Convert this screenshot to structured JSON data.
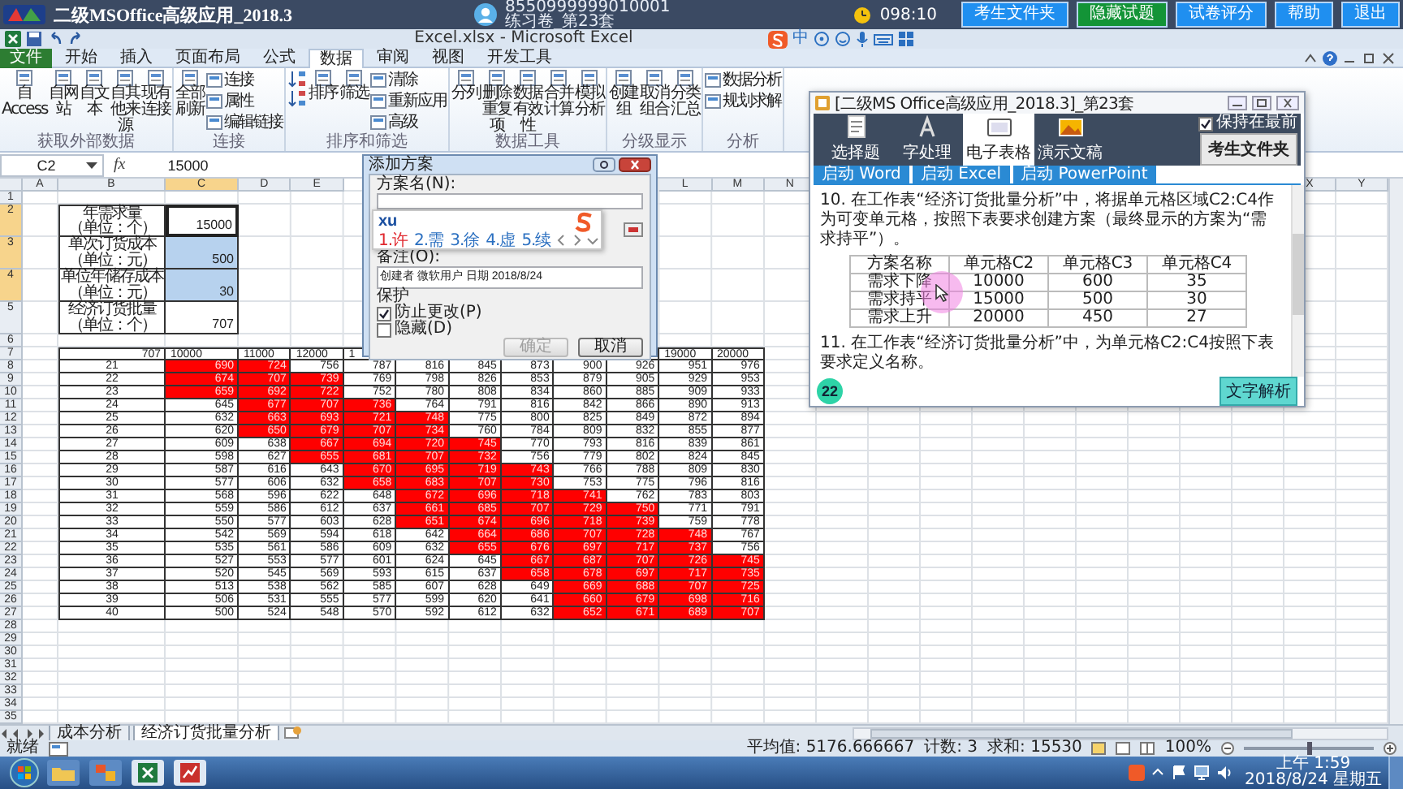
{
  "exam_bar": {
    "title": "二级MSOffice高级应用_2018.3",
    "user_id": "8550999999010001",
    "paper": "练习卷_第23套",
    "timer": "098:10",
    "buttons": [
      {
        "label": "考生文件夹",
        "kind": "normal"
      },
      {
        "label": "隐藏试题",
        "kind": "highlight"
      },
      {
        "label": "试卷评分",
        "kind": "normal"
      },
      {
        "label": "帮助",
        "kind": "normal"
      },
      {
        "label": "退出",
        "kind": "normal"
      }
    ]
  },
  "excel": {
    "window_title": "Excel.xlsx - Microsoft Excel",
    "ime_mode": "中",
    "ribbon_tabs": [
      {
        "label": "文件",
        "kind": "file",
        "selected": false
      },
      {
        "label": "开始",
        "kind": "tab",
        "selected": false
      },
      {
        "label": "插入",
        "kind": "tab",
        "selected": false
      },
      {
        "label": "页面布局",
        "kind": "tab",
        "selected": false
      },
      {
        "label": "公式",
        "kind": "tab",
        "selected": false
      },
      {
        "label": "数据",
        "kind": "tab",
        "selected": true
      },
      {
        "label": "审阅",
        "kind": "tab",
        "selected": false
      },
      {
        "label": "视图",
        "kind": "tab",
        "selected": false
      },
      {
        "label": "开发工具",
        "kind": "tab",
        "selected": false
      }
    ],
    "ribbon_groups": [
      {
        "label": "获取外部数据",
        "items": [
          {
            "kind": "large",
            "label": "自 Access"
          },
          {
            "kind": "large",
            "label": "自网站"
          },
          {
            "kind": "large",
            "label": "自文本"
          },
          {
            "kind": "large",
            "label": "自其他来源"
          },
          {
            "kind": "large",
            "label": "现有连接"
          }
        ]
      },
      {
        "label": "连接",
        "items": [
          {
            "kind": "large",
            "label": "全部刷新"
          },
          {
            "kind": "small",
            "label": "连接"
          },
          {
            "kind": "small",
            "label": "属性"
          },
          {
            "kind": "small",
            "label": "编辑链接"
          }
        ]
      },
      {
        "label": "排序和筛选",
        "items": [
          {
            "kind": "sort"
          },
          {
            "kind": "large",
            "label": "排序"
          },
          {
            "kind": "large",
            "label": "筛选"
          },
          {
            "kind": "small",
            "label": "清除"
          },
          {
            "kind": "small",
            "label": "重新应用"
          },
          {
            "kind": "small",
            "label": "高级"
          }
        ]
      },
      {
        "label": "数据工具",
        "items": [
          {
            "kind": "large",
            "label": "分列"
          },
          {
            "kind": "large",
            "label": "删除重复项"
          },
          {
            "kind": "large",
            "label": "数据有效性"
          },
          {
            "kind": "large",
            "label": "合并计算"
          },
          {
            "kind": "large",
            "label": "模拟分析"
          }
        ]
      },
      {
        "label": "分级显示",
        "items": [
          {
            "kind": "large",
            "label": "创建组"
          },
          {
            "kind": "large",
            "label": "取消组合"
          },
          {
            "kind": "large",
            "label": "分类汇总"
          }
        ]
      },
      {
        "label": "分析",
        "items": [
          {
            "kind": "small",
            "label": "数据分析"
          },
          {
            "kind": "small",
            "label": "规划求解"
          }
        ]
      }
    ],
    "name_box": "C2",
    "function_label": "fx",
    "formula": "15000"
  },
  "sheet": {
    "columns": [
      {
        "label": "A",
        "selected": false
      },
      {
        "label": "B",
        "selected": false
      },
      {
        "label": "C",
        "selected": true
      },
      {
        "label": "D",
        "selected": false
      },
      {
        "label": "E",
        "selected": false
      },
      null,
      null,
      null,
      null,
      null,
      null,
      {
        "label": "L",
        "selected": false
      },
      {
        "label": "M",
        "selected": false
      },
      {
        "label": "N",
        "selected": false
      },
      null,
      null,
      null,
      null,
      null,
      null,
      null,
      null,
      null,
      {
        "label": "X",
        "selected": false
      },
      {
        "label": "Y",
        "selected": false
      }
    ],
    "rows": [
      {
        "label": "1",
        "selected": false
      },
      {
        "label": "2",
        "selected": true
      },
      {
        "label": "3",
        "selected": true
      },
      {
        "label": "4",
        "selected": true
      },
      {
        "label": "5",
        "selected": false
      },
      {
        "label": "6",
        "selected": false
      },
      {
        "label": "7",
        "selected": false
      },
      {
        "label": "8",
        "selected": false
      },
      {
        "label": "9",
        "selected": false
      },
      {
        "label": "10",
        "selected": false
      },
      {
        "label": "11",
        "selected": false
      },
      {
        "label": "12",
        "selected": false
      },
      {
        "label": "13",
        "selected": false
      },
      {
        "label": "14",
        "selected": false
      },
      {
        "label": "15",
        "selected": false
      },
      {
        "label": "16",
        "selected": false
      },
      {
        "label": "17",
        "selected": false
      },
      {
        "label": "18",
        "selected": false
      },
      {
        "label": "19",
        "selected": false
      },
      {
        "label": "20",
        "selected": false
      },
      {
        "label": "21",
        "selected": false
      },
      {
        "label": "22",
        "selected": false
      },
      {
        "label": "23",
        "selected": false
      },
      {
        "label": "24",
        "selected": false
      },
      {
        "label": "25",
        "selected": false
      },
      {
        "label": "26",
        "selected": false
      },
      {
        "label": "27",
        "selected": false
      },
      {
        "label": "28",
        "selected": false
      },
      {
        "label": "29",
        "selected": false
      },
      {
        "label": "30",
        "selected": false
      },
      {
        "label": "31",
        "selected": false
      },
      {
        "label": "32",
        "selected": false
      },
      {
        "label": "33",
        "selected": false
      },
      {
        "label": "34",
        "selected": false
      },
      {
        "label": "35",
        "selected": false
      }
    ],
    "input_block": [
      {
        "label": "年需求量",
        "unit": "（单位：个）",
        "value": "15000",
        "selected": false,
        "active": true
      },
      {
        "label": "单次订货成本",
        "unit": "（单位：元）",
        "value": "500",
        "selected": true,
        "active": false
      },
      {
        "label": "单位年储存成本",
        "unit": "（单位：元）",
        "value": "30",
        "selected": true,
        "active": false
      },
      {
        "label": "经济订货批量",
        "unit": "（单位：个）",
        "value": "707",
        "selected": false,
        "active": false
      }
    ],
    "table": {
      "corner": "707",
      "columns": [
        "10000",
        "11000",
        "12000",
        "1",
        null,
        null,
        null,
        null,
        null,
        "19000",
        "20000"
      ],
      "rows": [
        {
          "label": "21",
          "cells": [
            "690",
            "724",
            "756",
            "787",
            "816",
            "845",
            "873",
            "900",
            "926",
            "951",
            "976"
          ],
          "highlighted": [
            true,
            true,
            false,
            false,
            false,
            false,
            false,
            false,
            false,
            false,
            false
          ]
        },
        {
          "label": "22",
          "cells": [
            "674",
            "707",
            "739",
            "769",
            "798",
            "826",
            "853",
            "879",
            "905",
            "929",
            "953"
          ],
          "highlighted": [
            true,
            true,
            true,
            false,
            false,
            false,
            false,
            false,
            false,
            false,
            false
          ]
        },
        {
          "label": "23",
          "cells": [
            "659",
            "692",
            "722",
            "752",
            "780",
            "808",
            "834",
            "860",
            "885",
            "909",
            "933"
          ],
          "highlighted": [
            true,
            true,
            true,
            false,
            false,
            false,
            false,
            false,
            false,
            false,
            false
          ]
        },
        {
          "label": "24",
          "cells": [
            "645",
            "677",
            "707",
            "736",
            "764",
            "791",
            "816",
            "842",
            "866",
            "890",
            "913"
          ],
          "highlighted": [
            false,
            true,
            true,
            true,
            false,
            false,
            false,
            false,
            false,
            false,
            false
          ]
        },
        {
          "label": "25",
          "cells": [
            "632",
            "663",
            "693",
            "721",
            "748",
            "775",
            "800",
            "825",
            "849",
            "872",
            "894"
          ],
          "highlighted": [
            false,
            true,
            true,
            true,
            true,
            false,
            false,
            false,
            false,
            false,
            false
          ]
        },
        {
          "label": "26",
          "cells": [
            "620",
            "650",
            "679",
            "707",
            "734",
            "760",
            "784",
            "809",
            "832",
            "855",
            "877"
          ],
          "highlighted": [
            false,
            true,
            true,
            true,
            true,
            false,
            false,
            false,
            false,
            false,
            false
          ]
        },
        {
          "label": "27",
          "cells": [
            "609",
            "638",
            "667",
            "694",
            "720",
            "745",
            "770",
            "793",
            "816",
            "839",
            "861"
          ],
          "highlighted": [
            false,
            false,
            true,
            true,
            true,
            true,
            false,
            false,
            false,
            false,
            false
          ]
        },
        {
          "label": "28",
          "cells": [
            "598",
            "627",
            "655",
            "681",
            "707",
            "732",
            "756",
            "779",
            "802",
            "824",
            "845"
          ],
          "highlighted": [
            false,
            false,
            true,
            true,
            true,
            true,
            false,
            false,
            false,
            false,
            false
          ]
        },
        {
          "label": "29",
          "cells": [
            "587",
            "616",
            "643",
            "670",
            "695",
            "719",
            "743",
            "766",
            "788",
            "809",
            "830"
          ],
          "highlighted": [
            false,
            false,
            false,
            true,
            true,
            true,
            true,
            false,
            false,
            false,
            false
          ]
        },
        {
          "label": "30",
          "cells": [
            "577",
            "606",
            "632",
            "658",
            "683",
            "707",
            "730",
            "753",
            "775",
            "796",
            "816"
          ],
          "highlighted": [
            false,
            false,
            false,
            true,
            true,
            true,
            true,
            false,
            false,
            false,
            false
          ]
        },
        {
          "label": "31",
          "cells": [
            "568",
            "596",
            "622",
            "648",
            "672",
            "696",
            "718",
            "741",
            "762",
            "783",
            "803"
          ],
          "highlighted": [
            false,
            false,
            false,
            false,
            true,
            true,
            true,
            true,
            false,
            false,
            false
          ]
        },
        {
          "label": "32",
          "cells": [
            "559",
            "586",
            "612",
            "637",
            "661",
            "685",
            "707",
            "729",
            "750",
            "771",
            "791"
          ],
          "highlighted": [
            false,
            false,
            false,
            false,
            true,
            true,
            true,
            true,
            true,
            false,
            false
          ]
        },
        {
          "label": "33",
          "cells": [
            "550",
            "577",
            "603",
            "628",
            "651",
            "674",
            "696",
            "718",
            "739",
            "759",
            "778"
          ],
          "highlighted": [
            false,
            false,
            false,
            false,
            true,
            true,
            true,
            true,
            true,
            false,
            false
          ]
        },
        {
          "label": "34",
          "cells": [
            "542",
            "569",
            "594",
            "618",
            "642",
            "664",
            "686",
            "707",
            "728",
            "748",
            "767"
          ],
          "highlighted": [
            false,
            false,
            false,
            false,
            false,
            true,
            true,
            true,
            true,
            true,
            false
          ]
        },
        {
          "label": "35",
          "cells": [
            "535",
            "561",
            "586",
            "609",
            "632",
            "655",
            "676",
            "697",
            "717",
            "737",
            "756"
          ],
          "highlighted": [
            false,
            false,
            false,
            false,
            false,
            true,
            true,
            true,
            true,
            true,
            false
          ]
        },
        {
          "label": "36",
          "cells": [
            "527",
            "553",
            "577",
            "601",
            "624",
            "645",
            "667",
            "687",
            "707",
            "726",
            "745"
          ],
          "highlighted": [
            false,
            false,
            false,
            false,
            false,
            false,
            true,
            true,
            true,
            true,
            true
          ]
        },
        {
          "label": "37",
          "cells": [
            "520",
            "545",
            "569",
            "593",
            "615",
            "637",
            "658",
            "678",
            "697",
            "717",
            "735"
          ],
          "highlighted": [
            false,
            false,
            false,
            false,
            false,
            false,
            true,
            true,
            true,
            true,
            true
          ]
        },
        {
          "label": "38",
          "cells": [
            "513",
            "538",
            "562",
            "585",
            "607",
            "628",
            "649",
            "669",
            "688",
            "707",
            "725"
          ],
          "highlighted": [
            false,
            false,
            false,
            false,
            false,
            false,
            false,
            true,
            true,
            true,
            true
          ]
        },
        {
          "label": "39",
          "cells": [
            "506",
            "531",
            "555",
            "577",
            "599",
            "620",
            "641",
            "660",
            "679",
            "698",
            "716"
          ],
          "highlighted": [
            false,
            false,
            false,
            false,
            false,
            false,
            false,
            true,
            true,
            true,
            true
          ]
        },
        {
          "label": "40",
          "cells": [
            "500",
            "524",
            "548",
            "570",
            "592",
            "612",
            "632",
            "652",
            "671",
            "689",
            "707"
          ],
          "highlighted": [
            false,
            false,
            false,
            false,
            false,
            false,
            false,
            true,
            true,
            true,
            true
          ]
        }
      ]
    }
  },
  "sheet_tabs": [
    {
      "label": "成本分析",
      "selected": false
    },
    {
      "label": "经济订货批量分析",
      "selected": true
    }
  ],
  "status_bar": {
    "mode": "就绪",
    "average": "平均值: 5176.666667",
    "count": "计数: 3",
    "sum": "求和: 15530",
    "zoom": "100%",
    "zoom_slider": {
      "level": 0.5
    }
  },
  "taskbar": {
    "time": "上午 1:59",
    "date": "2018/8/24 星期五"
  },
  "scenario_dialog": {
    "title": "添加方案",
    "name_label": "方案名(N):",
    "comment_label": "备注(O):",
    "comment": "创建者 微软用户 日期 2018/8/24",
    "protect_label": "保护",
    "options": [
      {
        "label": "防止更改(P)",
        "checked": true
      },
      {
        "label": "隐藏(D)",
        "checked": false
      }
    ],
    "buttons": [
      {
        "label": "确定",
        "disabled": true
      },
      {
        "label": "取消",
        "disabled": false
      }
    ],
    "ime": {
      "input": "xu",
      "candidates": [
        {
          "text": "1.许",
          "selected": true
        },
        {
          "text": "2.需",
          "selected": false
        },
        {
          "text": "3.徐",
          "selected": false
        },
        {
          "text": "4.虚",
          "selected": false
        },
        {
          "text": "5.续",
          "selected": false
        }
      ]
    }
  },
  "question_panel": {
    "title": "[二级MS Office高级应用_2018.3]_第23套",
    "tabs": [
      {
        "label": "选择题",
        "selected": false
      },
      {
        "label": "字处理",
        "selected": false
      },
      {
        "label": "电子表格",
        "selected": true
      },
      {
        "label": "演示文稿",
        "selected": false
      }
    ],
    "keep_on_top": {
      "label": "保持在最前",
      "checked": true
    },
    "folder_button": "考生文件夹",
    "launchers": [
      "启动 Word",
      "启动 Excel",
      "启动 PowerPoint"
    ],
    "question": "10. 在工作表“经济订货批量分析”中，将据单元格区域C2:C4作为可变单元格，按照下表要求创建方案（最终显示的方案为“需求持平”）。",
    "scenario_table": {
      "header": [
        "方案名称",
        "单元格C2",
        "单元格C3",
        "单元格C4"
      ],
      "rows": [
        [
          "需求下降",
          "10000",
          "600",
          "35"
        ],
        [
          "需求持平",
          "15000",
          "500",
          "30"
        ],
        [
          "需求上升",
          "20000",
          "450",
          "27"
        ]
      ]
    },
    "next_question": "11. 在工作表“经济订货批量分析”中，为单元格C2:C4按照下表要求定义名称。",
    "number": "22",
    "analysis_button": "文字解析"
  }
}
